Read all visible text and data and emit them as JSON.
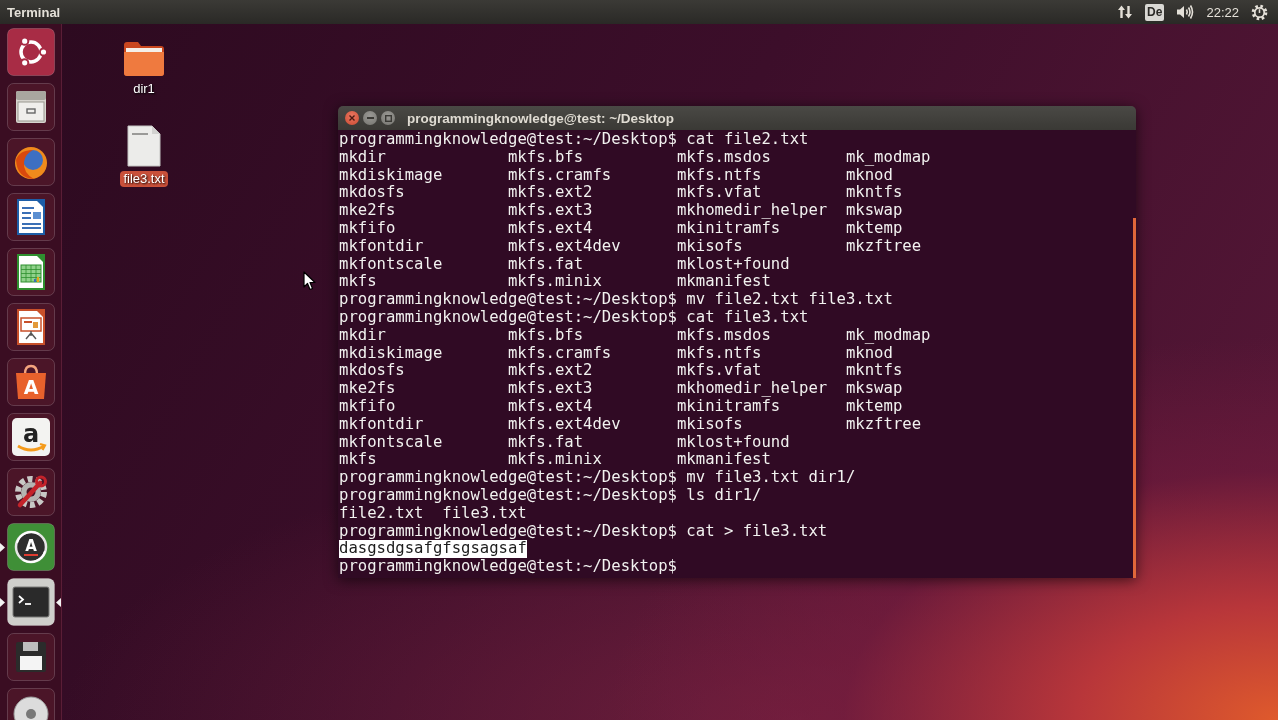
{
  "top_panel": {
    "app_title": "Terminal",
    "keyboard_layout": "De",
    "clock": "22:22"
  },
  "launcher": [
    {
      "kind": "dash",
      "running": false,
      "focused": false
    },
    {
      "kind": "files",
      "running": false,
      "focused": false
    },
    {
      "kind": "browser",
      "running": false,
      "focused": false
    },
    {
      "kind": "writer",
      "running": false,
      "focused": false
    },
    {
      "kind": "calc",
      "running": false,
      "focused": false
    },
    {
      "kind": "impress",
      "running": false,
      "focused": false
    },
    {
      "kind": "store",
      "glyph": "A",
      "running": false,
      "focused": false
    },
    {
      "kind": "amazon",
      "glyph": "a",
      "running": false,
      "focused": false
    },
    {
      "kind": "settings",
      "running": false,
      "focused": false
    },
    {
      "kind": "updater",
      "glyph": "A",
      "running": true,
      "focused": false
    },
    {
      "kind": "terminal",
      "running": true,
      "focused": true
    },
    {
      "kind": "drive",
      "running": false,
      "focused": false
    },
    {
      "kind": "disc",
      "running": false,
      "focused": false
    }
  ],
  "desktop_icons": [
    {
      "kind": "folder",
      "label": "dir1",
      "selected": false
    },
    {
      "kind": "textfile",
      "label": "file3.txt",
      "selected": true
    }
  ],
  "terminal": {
    "title": "programmingknowledge@test: ~/Desktop",
    "lines": [
      {
        "kind": "prompt",
        "prompt": "programmingknowledge@test:~/Desktop$",
        "command": "cat file2.txt"
      },
      {
        "kind": "table",
        "rows": [
          [
            "mkdir",
            "mkfs.bfs",
            "mkfs.msdos",
            "mk_modmap"
          ],
          [
            "mkdiskimage",
            "mkfs.cramfs",
            "mkfs.ntfs",
            "mknod"
          ],
          [
            "mkdosfs",
            "mkfs.ext2",
            "mkfs.vfat",
            "mkntfs"
          ],
          [
            "mke2fs",
            "mkfs.ext3",
            "mkhomedir_helper",
            "mkswap"
          ],
          [
            "mkfifo",
            "mkfs.ext4",
            "mkinitramfs",
            "mktemp"
          ],
          [
            "mkfontdir",
            "mkfs.ext4dev",
            "mkisofs",
            "mkzftree"
          ],
          [
            "mkfontscale",
            "mkfs.fat",
            "mklost+found"
          ],
          [
            "mkfs",
            "mkfs.minix",
            "mkmanifest"
          ]
        ]
      },
      {
        "kind": "prompt",
        "prompt": "programmingknowledge@test:~/Desktop$",
        "command": "mv file2.txt file3.txt"
      },
      {
        "kind": "prompt",
        "prompt": "programmingknowledge@test:~/Desktop$",
        "command": "cat file3.txt"
      },
      {
        "kind": "table",
        "rows": [
          [
            "mkdir",
            "mkfs.bfs",
            "mkfs.msdos",
            "mk_modmap"
          ],
          [
            "mkdiskimage",
            "mkfs.cramfs",
            "mkfs.ntfs",
            "mknod"
          ],
          [
            "mkdosfs",
            "mkfs.ext2",
            "mkfs.vfat",
            "mkntfs"
          ],
          [
            "mke2fs",
            "mkfs.ext3",
            "mkhomedir_helper",
            "mkswap"
          ],
          [
            "mkfifo",
            "mkfs.ext4",
            "mkinitramfs",
            "mktemp"
          ],
          [
            "mkfontdir",
            "mkfs.ext4dev",
            "mkisofs",
            "mkzftree"
          ],
          [
            "mkfontscale",
            "mkfs.fat",
            "mklost+found"
          ],
          [
            "mkfs",
            "mkfs.minix",
            "mkmanifest"
          ]
        ]
      },
      {
        "kind": "prompt",
        "prompt": "programmingknowledge@test:~/Desktop$",
        "command": "mv file3.txt dir1/"
      },
      {
        "kind": "prompt",
        "prompt": "programmingknowledge@test:~/Desktop$",
        "command": "ls dir1/"
      },
      {
        "kind": "files",
        "names": [
          "file2.txt",
          "file3.txt"
        ]
      },
      {
        "kind": "prompt",
        "prompt": "programmingknowledge@test:~/Desktop$",
        "command": "cat > file3.txt"
      },
      {
        "kind": "text",
        "text": "dasgsdgsafgfsgsagsaf",
        "highlighted": true
      },
      {
        "kind": "prompt",
        "prompt": "programmingknowledge@test:~/Desktop$"
      }
    ]
  }
}
